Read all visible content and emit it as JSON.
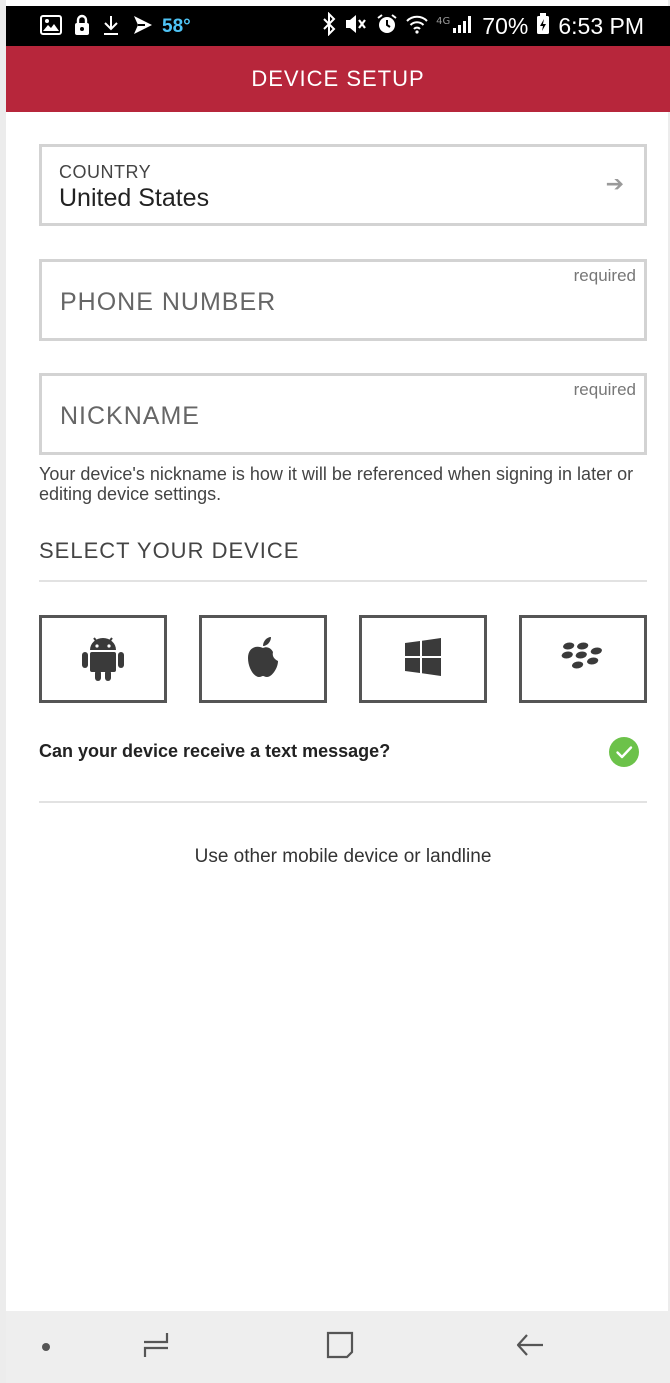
{
  "status_bar": {
    "temperature": "58°",
    "battery": "70%",
    "time": "6:53 PM",
    "network_type": "4G",
    "icons": [
      "gallery-icon",
      "lock-icon",
      "download-icon",
      "send-icon",
      "bluetooth-icon",
      "mute-icon",
      "alarm-icon",
      "wifi-icon",
      "signal-icon",
      "battery-icon"
    ]
  },
  "app_bar": {
    "title": "DEVICE SETUP"
  },
  "form": {
    "country": {
      "label": "COUNTRY",
      "value": "United States"
    },
    "phone": {
      "placeholder": "PHONE NUMBER",
      "required_label": "required"
    },
    "nickname": {
      "placeholder": "NICKNAME",
      "required_label": "required",
      "helper": "Your device's nickname is how it will be referenced when signing in later or editing device settings."
    }
  },
  "device_select": {
    "title": "SELECT YOUR DEVICE",
    "options": [
      "android-icon",
      "apple-icon",
      "windows-icon",
      "blackberry-icon"
    ]
  },
  "text_message": {
    "question": "Can your device receive a text message?",
    "checked": true
  },
  "other_option": {
    "label": "Use other mobile device or landline"
  },
  "colors": {
    "brand": "#b7263b",
    "check": "#6cc24a",
    "field_border": "#d3d3d3",
    "device_border": "#555555"
  }
}
